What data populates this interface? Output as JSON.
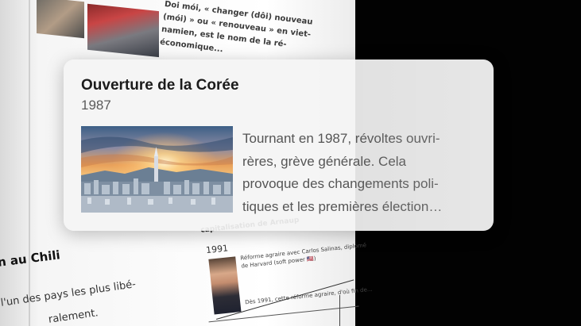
{
  "background_page": {
    "top_text_lines": [
      "Doi mói, « changer (dôi) nouveau",
      "(mói) » ou « renouveau » en viet-",
      "namien, est le nom de la ré-",
      "économique..."
    ],
    "section_title": "n au Chili",
    "body_lines": [
      "l'un des pays les plus libé-",
      "ralement."
    ],
    "subcard": {
      "title": "capitalisation de Arnaup",
      "year": "1991",
      "text_lines": [
        "Réforme agraire avec Carlos Salinas, diplomé",
        "de Harvard (soft power 🇺🇸)",
        "Dès 1991, cette réforme agraire, d'où fin de..."
      ]
    }
  },
  "popup": {
    "title": "Ouverture de la Corée",
    "date": "1987",
    "description_lines": [
      "Tournant en 1987, révoltes ouvri-",
      "rères, grève générale. Cela",
      "provoque des changements poli-",
      "tiques et les premières élection…"
    ]
  },
  "colors": {
    "popup_bg": "#f4f4f4",
    "title": "#1b1b1b",
    "date": "#5b5b5b",
    "description": "#555555",
    "backdrop": "#000000"
  }
}
